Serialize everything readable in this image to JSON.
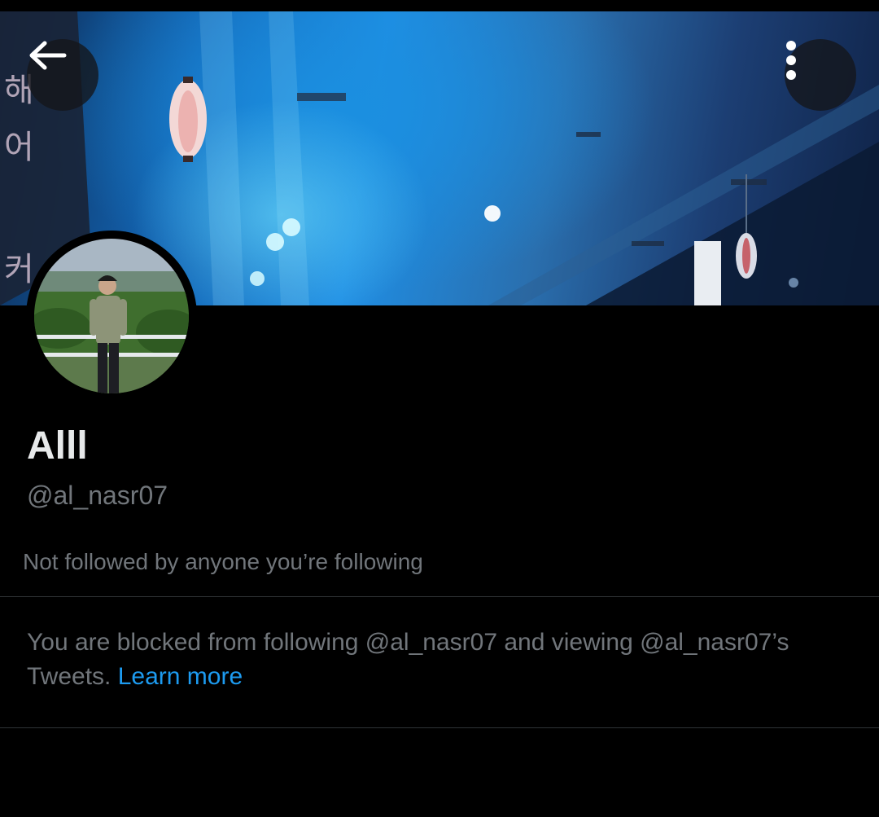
{
  "header": {
    "back_icon": "arrow-left-icon",
    "more_icon": "more-vertical-icon"
  },
  "profile": {
    "display_name": "Alll",
    "handle": "@al_nasr07",
    "mutual_followers": "Not followed by anyone you’re following"
  },
  "notice": {
    "text": "You are blocked from following @al_nasr07 and viewing @al_nasr07’s Tweets.",
    "link_label": "Learn more"
  },
  "colors": {
    "background": "#000000",
    "primary_text": "#e7e9ea",
    "secondary_text": "#71767b",
    "link": "#1d9bf0",
    "divider": "#2f3336"
  }
}
